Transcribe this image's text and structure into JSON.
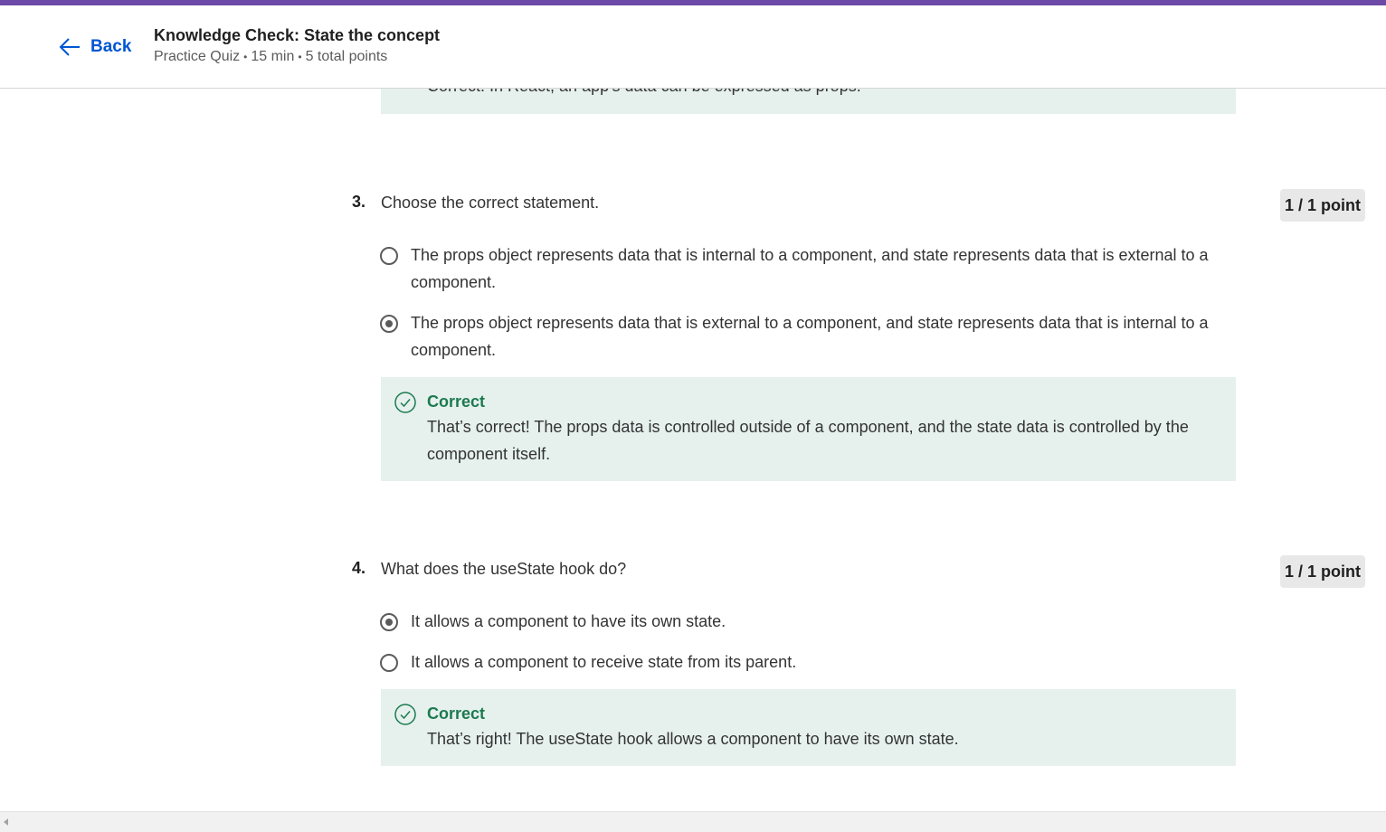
{
  "header": {
    "back_label": "Back",
    "title": "Knowledge Check: State the concept",
    "meta": [
      "Practice Quiz",
      "15 min",
      "5 total points"
    ],
    "meta_separator": "•"
  },
  "previous_feedback": {
    "text": "Correct. In React, an app's data can be expressed as props."
  },
  "questions": [
    {
      "number": "3.",
      "text": "Choose the correct statement.",
      "points": "1 / 1 point",
      "options": [
        {
          "text": "The props object represents data that is internal to a component, and state represents data that is external to a component.",
          "selected": false
        },
        {
          "text": "The props object represents data that is external to a component, and state represents data that is internal to a component.",
          "selected": true
        }
      ],
      "feedback": {
        "title": "Correct",
        "text": "That’s correct! The props data is controlled outside of a component, and the state data is controlled by the component itself."
      }
    },
    {
      "number": "4.",
      "text": "What does the useState hook do?",
      "points": "1 / 1 point",
      "options": [
        {
          "text": "It allows a component to have its own state.",
          "selected": true
        },
        {
          "text": "It allows a component to receive state from its parent.",
          "selected": false
        }
      ],
      "feedback": {
        "title": "Correct",
        "text": "That’s right! The useState hook allows a component to have its own state."
      }
    }
  ],
  "colors": {
    "accent_bar": "#6d49a8",
    "link": "#0056d2",
    "correct_green": "#1c7a4f",
    "feedback_bg": "#e6f1ee"
  }
}
